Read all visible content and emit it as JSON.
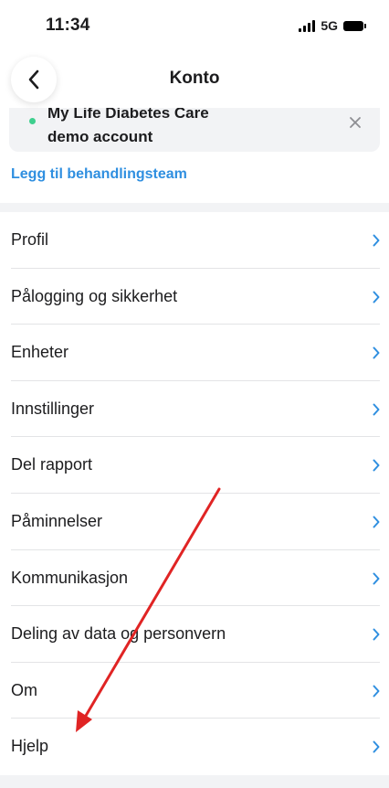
{
  "status_bar": {
    "time": "11:34",
    "network": "5G"
  },
  "nav": {
    "title": "Konto"
  },
  "care_team": {
    "name_line1": "My Life Diabetes Care",
    "name_line2": "demo account",
    "add_label": "Legg til behandlingsteam"
  },
  "menu": {
    "items": [
      {
        "label": "Profil"
      },
      {
        "label": "Pålogging og sikkerhet"
      },
      {
        "label": "Enheter"
      },
      {
        "label": "Innstillinger"
      },
      {
        "label": "Del rapport"
      },
      {
        "label": "Påminnelser"
      },
      {
        "label": "Kommunikasjon"
      },
      {
        "label": "Deling av data og personvern"
      },
      {
        "label": "Om"
      },
      {
        "label": "Hjelp"
      }
    ]
  },
  "colors": {
    "accent": "#2f8fe0",
    "status_dot": "#3ecf8e",
    "annotation_arrow": "#e02424"
  }
}
